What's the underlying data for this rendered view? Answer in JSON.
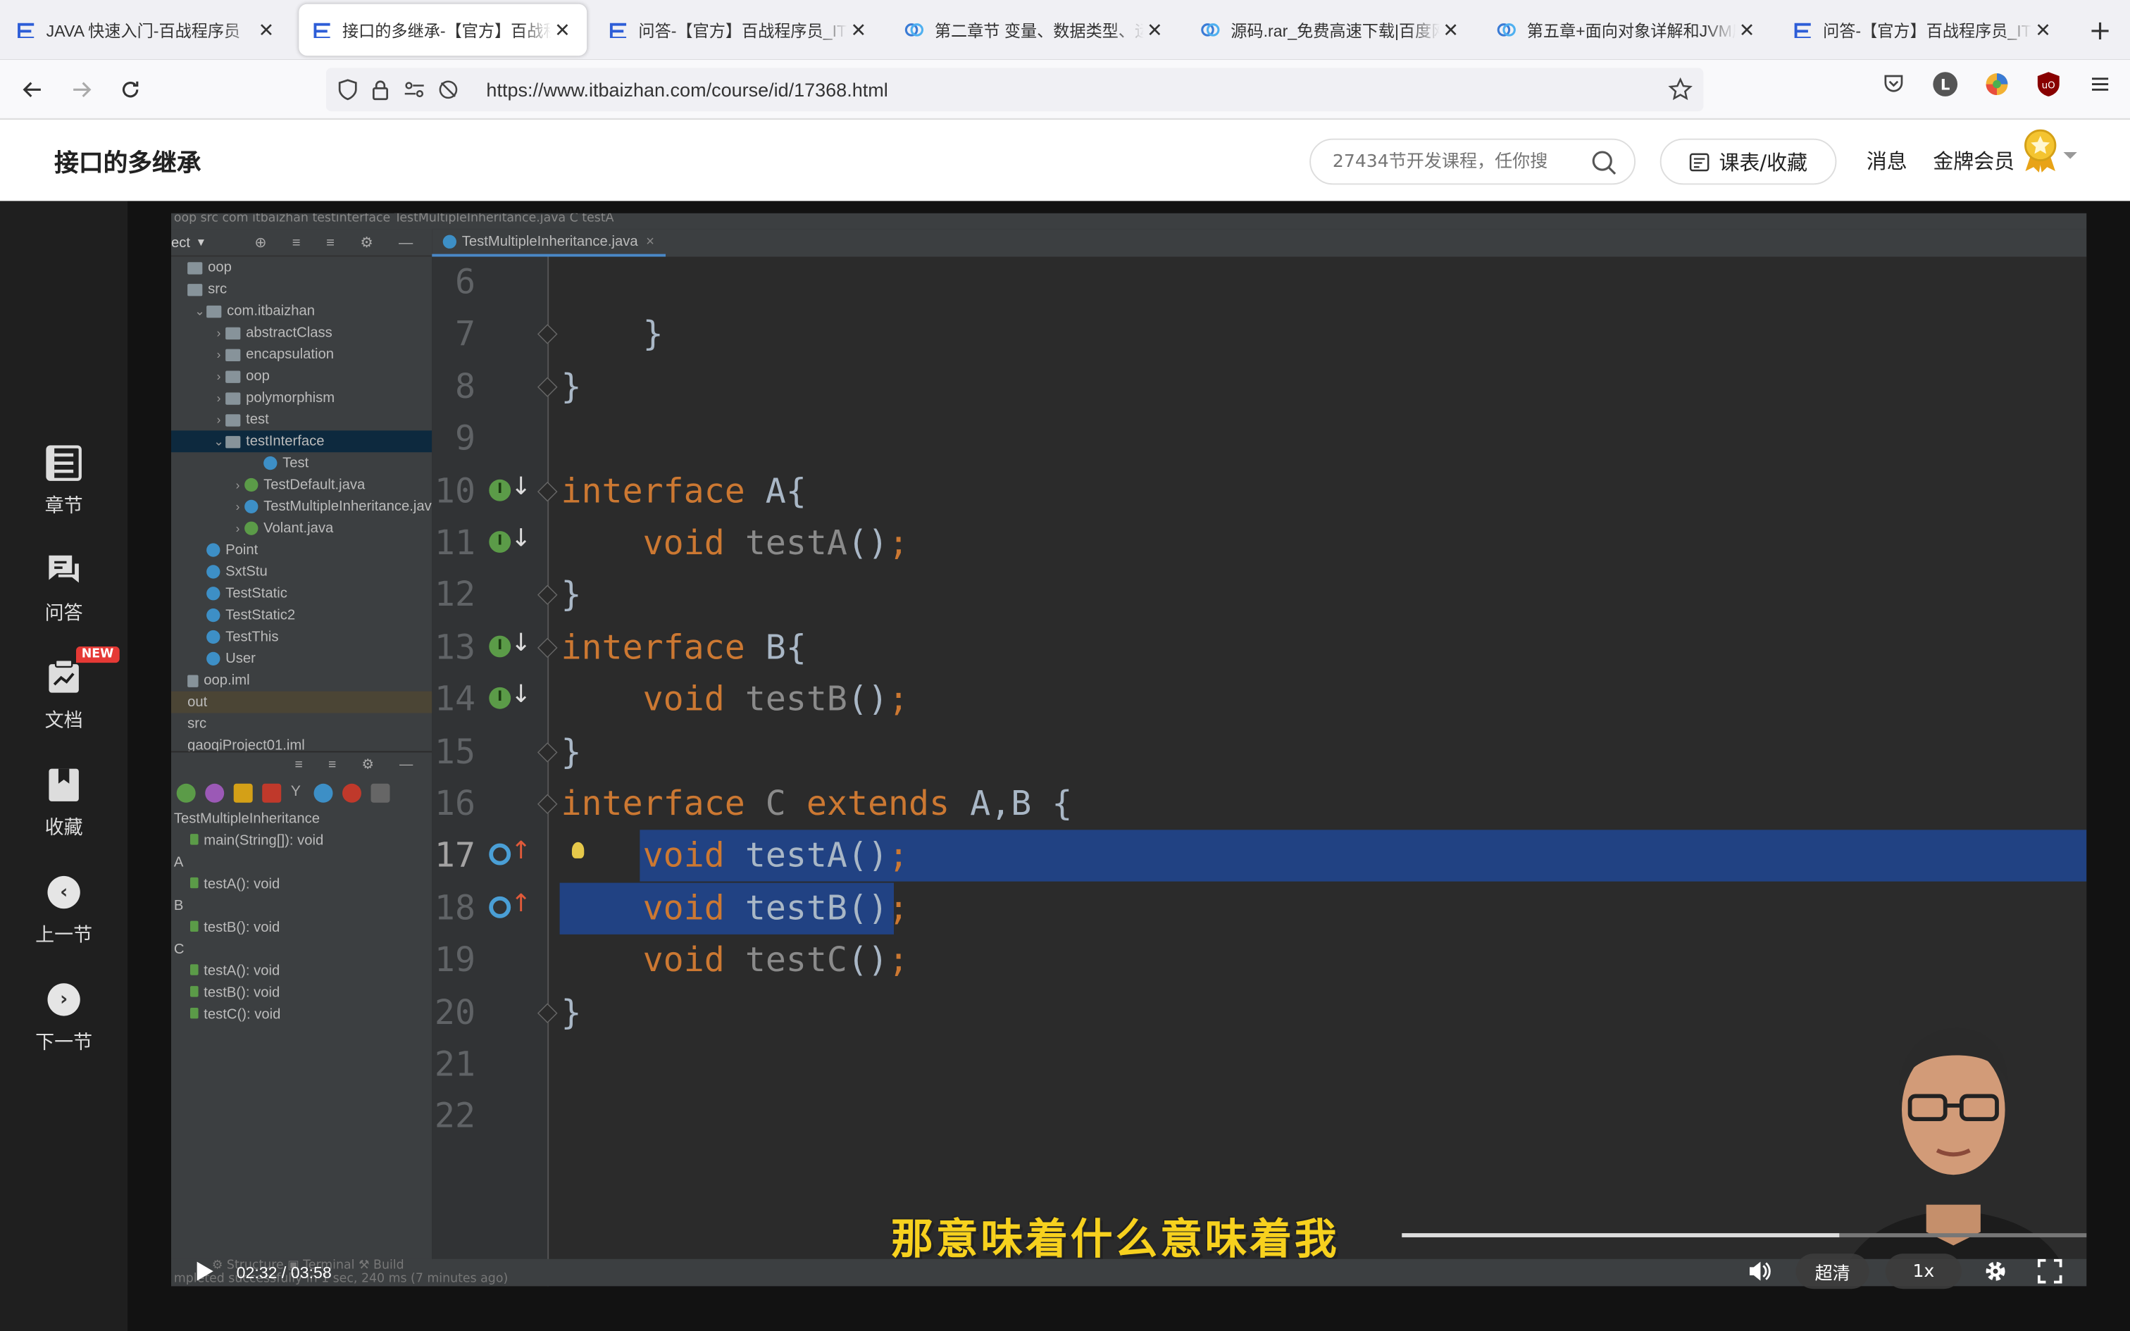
{
  "browser": {
    "tabs": [
      {
        "title": "JAVA 快速入门-百战程序员",
        "icon": "itbaizhan-icon",
        "active": false
      },
      {
        "title": "接口的多继承-【官方】百战程序员",
        "icon": "itbaizhan-icon",
        "active": true
      },
      {
        "title": "问答-【官方】百战程序员_IT在线",
        "icon": "itbaizhan-icon",
        "active": false
      },
      {
        "title": "第二章节 变量、数据类型、运算",
        "icon": "baidu-netdisk-icon",
        "active": false
      },
      {
        "title": "源码.rar_免费高速下载|百度网盘",
        "icon": "baidu-netdisk-icon",
        "active": false
      },
      {
        "title": "第五章+面向对象详解和JVM底层",
        "icon": "baidu-netdisk-icon",
        "active": false
      },
      {
        "title": "问答-【官方】百战程序员_IT在线",
        "icon": "itbaizhan-icon",
        "active": false
      }
    ],
    "url": "https://www.itbaizhan.com/course/id/17368.html",
    "profile_letter": "L"
  },
  "site": {
    "page_title": "接口的多继承",
    "search_placeholder": "27434节开发课程，任你搜",
    "schedule_label": "课表/收藏",
    "messages_label": "消息",
    "vip_label": "金牌会员"
  },
  "sidebar": {
    "items": [
      {
        "label": "章节",
        "icon": "chapters-icon"
      },
      {
        "label": "问答",
        "icon": "qa-icon"
      },
      {
        "label": "文档",
        "icon": "document-icon",
        "badge": "NEW"
      },
      {
        "label": "收藏",
        "icon": "bookmark-icon"
      },
      {
        "label": "上一节",
        "icon": "prev-icon"
      },
      {
        "label": "下一节",
        "icon": "next-icon"
      }
    ]
  },
  "ide": {
    "project_header": "ect",
    "breadcrumb": "oop  src  com  itbaizhan  testinterface  TestMultipleInheritance.java  C  testA",
    "tree": [
      {
        "label": "oop",
        "indent": 0,
        "type": "folder"
      },
      {
        "label": "src",
        "indent": 0,
        "type": "folder"
      },
      {
        "label": "com.itbaizhan",
        "indent": 1,
        "type": "folder",
        "arrow": "v"
      },
      {
        "label": "abstractClass",
        "indent": 2,
        "type": "folder",
        "arrow": ">"
      },
      {
        "label": "encapsulation",
        "indent": 2,
        "type": "folder",
        "arrow": ">"
      },
      {
        "label": "oop",
        "indent": 2,
        "type": "folder",
        "arrow": ">"
      },
      {
        "label": "polymorphism",
        "indent": 2,
        "type": "folder",
        "arrow": ">"
      },
      {
        "label": "test",
        "indent": 2,
        "type": "folder",
        "arrow": ">"
      },
      {
        "label": "testInterface",
        "indent": 2,
        "type": "folder",
        "arrow": "v",
        "selected": true
      },
      {
        "label": "Test",
        "indent": 4,
        "type": "class"
      },
      {
        "label": "TestDefault.java",
        "indent": 3,
        "type": "interface",
        "arrow": ">"
      },
      {
        "label": "TestMultipleInheritance.jav",
        "indent": 3,
        "type": "class",
        "arrow": ">"
      },
      {
        "label": "Volant.java",
        "indent": 3,
        "type": "interface",
        "arrow": ">"
      },
      {
        "label": "Point",
        "indent": 1,
        "type": "class"
      },
      {
        "label": "SxtStu",
        "indent": 1,
        "type": "class"
      },
      {
        "label": "TestStatic",
        "indent": 1,
        "type": "class"
      },
      {
        "label": "TestStatic2",
        "indent": 1,
        "type": "class"
      },
      {
        "label": "TestThis",
        "indent": 1,
        "type": "class"
      },
      {
        "label": "User",
        "indent": 1,
        "type": "class"
      },
      {
        "label": "oop.iml",
        "indent": 0,
        "type": "file"
      },
      {
        "label": "out",
        "indent": 0,
        "type": "plain",
        "highlight": true
      },
      {
        "label": "src",
        "indent": 0,
        "type": "plain"
      },
      {
        "label": "gaoqiProject01.iml",
        "indent": 0,
        "type": "plain"
      }
    ],
    "structure": [
      {
        "label": "TestMultipleInheritance",
        "indent": 0
      },
      {
        "label": "main(String[]): void",
        "indent": 1
      },
      {
        "label": "A",
        "indent": 0
      },
      {
        "label": "testA(): void",
        "indent": 1
      },
      {
        "label": "B",
        "indent": 0
      },
      {
        "label": "testB(): void",
        "indent": 1
      },
      {
        "label": "C",
        "indent": 0
      },
      {
        "label": "testA(): void",
        "indent": 1
      },
      {
        "label": "testB(): void",
        "indent": 1
      },
      {
        "label": "testC(): void",
        "indent": 1
      }
    ],
    "editor_tab": "TestMultipleInheritance.java",
    "code_lines": [
      {
        "n": "6",
        "text": ""
      },
      {
        "n": "7",
        "text": "    }"
      },
      {
        "n": "8",
        "text": "}"
      },
      {
        "n": "9",
        "text": ""
      },
      {
        "n": "10",
        "text": "interface A{"
      },
      {
        "n": "11",
        "text": "    void testA();"
      },
      {
        "n": "12",
        "text": "}"
      },
      {
        "n": "13",
        "text": "interface B{"
      },
      {
        "n": "14",
        "text": "    void testB();"
      },
      {
        "n": "15",
        "text": "}"
      },
      {
        "n": "16",
        "text": "interface C extends A,B {"
      },
      {
        "n": "17",
        "text": "    void testA();"
      },
      {
        "n": "18",
        "text": "    void testB();"
      },
      {
        "n": "19",
        "text": "    void testC();"
      },
      {
        "n": "20",
        "text": "}"
      },
      {
        "n": "21",
        "text": ""
      },
      {
        "n": "22",
        "text": ""
      }
    ],
    "build_status": "mpleted successfully in 1 sec, 240 ms (7 minutes ago)"
  },
  "player": {
    "subtitle": "那意味着什么意味着我",
    "current_time": "02:32",
    "duration": "03:58",
    "time_display": "02:32 / 03:58",
    "quality_label": "超清",
    "speed_label": "1x",
    "progress_fraction": 0.638
  }
}
